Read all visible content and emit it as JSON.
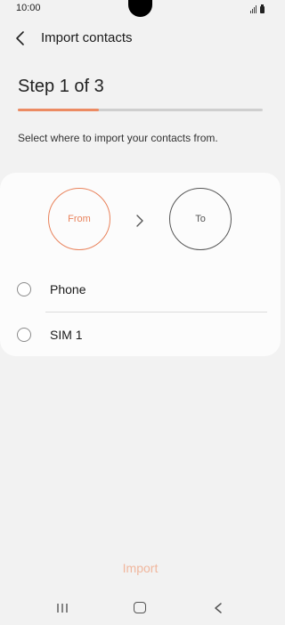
{
  "status_bar": {
    "time": "10:00"
  },
  "header": {
    "title": "Import contacts"
  },
  "wizard": {
    "step_label": "Step 1 of 3",
    "progress_fraction": 0.33,
    "instruction": "Select where to import your contacts from."
  },
  "flow": {
    "from_label": "From",
    "to_label": "To"
  },
  "sources": [
    {
      "label": "Phone",
      "selected": false
    },
    {
      "label": "SIM 1",
      "selected": false
    }
  ],
  "footer": {
    "import_label": "Import"
  },
  "colors": {
    "accent": "#e9835c",
    "progress": "#ec8b63",
    "disabled_accent": "#f0b79e",
    "background": "#f2f2f2"
  },
  "icons": {
    "back": "chevron-left-icon",
    "arrow": "chevron-right-icon",
    "nav_recents": "recents-icon",
    "nav_home": "home-icon",
    "nav_back": "back-icon"
  }
}
